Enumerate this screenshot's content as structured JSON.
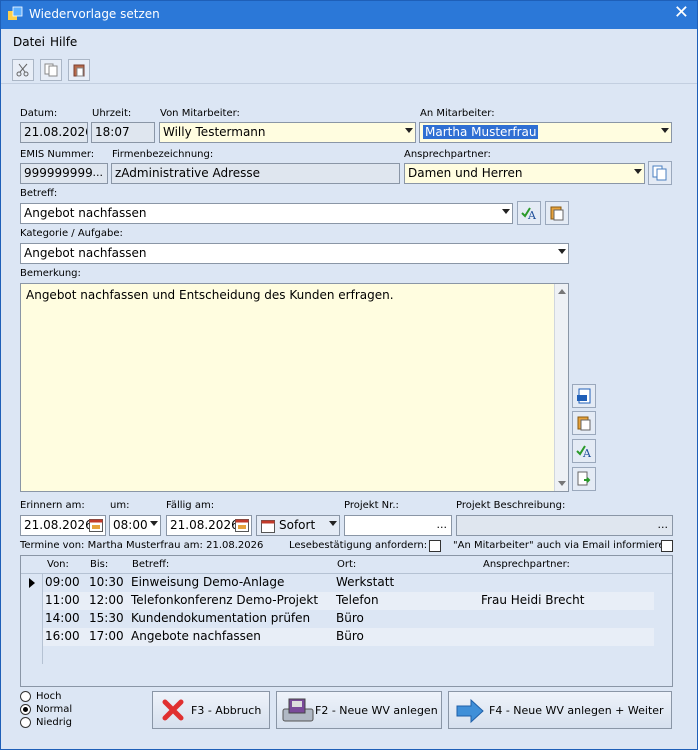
{
  "window": {
    "title": "Wiedervorlage setzen",
    "close_label": "✕"
  },
  "menu": {
    "file": "Datei",
    "help": "Hilfe"
  },
  "labels": {
    "date": "Datum:",
    "time": "Uhrzeit:",
    "from_employee": "Von Mitarbeiter:",
    "to_employee": "An Mitarbeiter:",
    "emis": "EMIS Nummer:",
    "company": "Firmenbezeichnung:",
    "contact": "Ansprechpartner:",
    "subject": "Betreff:",
    "category": "Kategorie / Aufgabe:",
    "remark": "Bemerkung:",
    "remind_on": "Erinnern am:",
    "at": "um:",
    "due_on": "Fällig am:",
    "project_no": "Projekt Nr.:",
    "project_desc": "Projekt Beschreibung:",
    "appointments": "Termine von: Martha Musterfrau am: 21.08.2026",
    "read_receipt": "Lesebestätigung anfordern:",
    "email_notify": "\"An Mitarbeiter\" auch via Email informieren"
  },
  "fields": {
    "date": "21.08.2026",
    "time": "18:07",
    "from_employee": "Willy Testermann",
    "to_employee": "Martha Musterfrau",
    "emis": "999999999",
    "company": "zAdministrative Adresse",
    "contact": "Damen und Herren",
    "subject": "Angebot nachfassen",
    "category": "Angebot nachfassen",
    "remark": "Angebot nachfassen und Entscheidung des Kunden erfragen.",
    "remind_date": "21.08.2026",
    "remind_time": "08:00",
    "due_date": "21.08.2026",
    "due_mode": "Sofort",
    "project_no": "",
    "project_desc": "",
    "dots": "..."
  },
  "table": {
    "columns": [
      "Von:",
      "Bis:",
      "Betreff:",
      "Ort:",
      "Ansprechpartner:"
    ],
    "rows": [
      [
        "09:00",
        "10:30",
        "Einweisung Demo-Anlage",
        "Werkstatt",
        ""
      ],
      [
        "11:00",
        "12:00",
        "Telefonkonferenz Demo-Projekt",
        "Telefon",
        "Frau Heidi Brecht"
      ],
      [
        "14:00",
        "15:30",
        "Kundendokumentation prüfen",
        "Büro",
        ""
      ],
      [
        "16:00",
        "17:00",
        "Angebote nachfassen",
        "Büro",
        ""
      ]
    ]
  },
  "priority": {
    "options": [
      "Hoch",
      "Normal",
      "Niedrig"
    ],
    "selected": "Normal"
  },
  "buttons": {
    "cancel": "F3 - Abbruch",
    "new": "F2 - Neue WV anlegen",
    "new_next": "F4 - Neue WV anlegen + Weiter"
  },
  "colors": {
    "titlebar": "#2b78d8",
    "window_bg": "#dce6f4",
    "input_yellow": "#fffde0",
    "selection": "#2f6fd3"
  }
}
